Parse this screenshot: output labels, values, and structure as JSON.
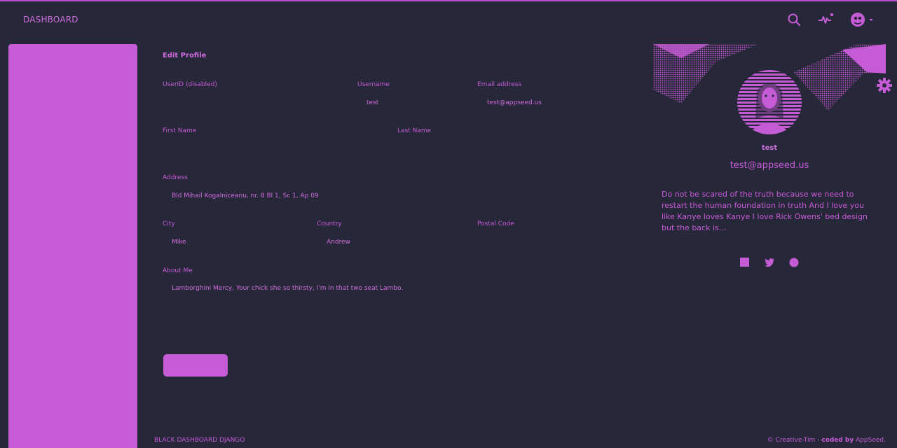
{
  "nav": {
    "brand": "DASHBOARD"
  },
  "profile_form": {
    "title": "Edit Profile",
    "userid_label": "UserID (disabled)",
    "userid_value": "",
    "username_label": "Username",
    "username_value": "test",
    "email_label": "Email address",
    "email_value": "test@appseed.us",
    "first_name_label": "First Name",
    "first_name_value": "",
    "last_name_label": "Last Name",
    "last_name_value": "",
    "address_label": "Address",
    "address_value": "Bld Mihail Kogalniceanu, nr. 8 Bl 1, Sc 1, Ap 09",
    "city_label": "City",
    "city_value": "Mike",
    "country_label": "Country",
    "country_value": "Andrew",
    "postal_label": "Postal Code",
    "postal_value": "",
    "about_label": "About Me",
    "about_value": "Lamborghini Mercy, Your chick she so thirsty, I'm in that two seat Lambo.",
    "save_label": ""
  },
  "user_card": {
    "name": "test",
    "email": "test@appseed.us",
    "bio": "Do not be scared of the truth because we need to restart the human foundation in truth And I love you like Kanye loves Kanye I love Rick Owens' bed design but the back is...",
    "social_icons": [
      "facebook-icon",
      "twitter-icon",
      "google-icon"
    ]
  },
  "footer": {
    "left": "BLACK DASHBOARD DJANGO",
    "right_prefix": "© Creative-Tim - ",
    "right_coded": "coded by",
    "right_suffix": " AppSeed."
  },
  "colors": {
    "background": "#27273a",
    "accent": "#c65bd6"
  }
}
